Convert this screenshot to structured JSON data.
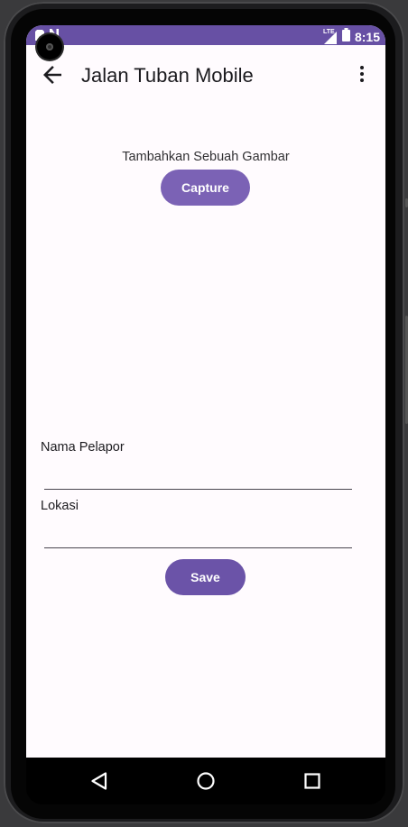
{
  "status_bar": {
    "time": "8:15",
    "network_label": "LTE",
    "icons": [
      "sim-icon",
      "notification-n-icon",
      "signal-icon",
      "battery-icon"
    ]
  },
  "app_bar": {
    "title": "Jalan Tuban Mobile",
    "back_icon": "arrow-back-icon",
    "menu_icon": "more-vert-icon"
  },
  "image_section": {
    "prompt": "Tambahkan Sebuah Gambar",
    "capture_label": "Capture"
  },
  "form": {
    "reporter_label": "Nama Pelapor",
    "reporter_value": "",
    "location_label": "Lokasi",
    "location_value": "",
    "save_label": "Save"
  },
  "nav_bar": {
    "icons": [
      "back-triangle-icon",
      "home-circle-icon",
      "recents-square-icon"
    ]
  },
  "colors": {
    "primary": "#6750a4",
    "button": "#7b62b5",
    "background": "#fffbfe",
    "text": "#1c1b1f"
  }
}
